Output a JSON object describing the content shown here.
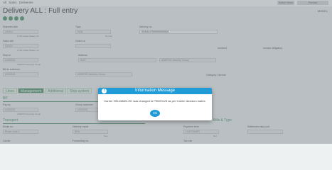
{
  "breadcrumb": [
    "All",
    "Sales",
    "Deliveries"
  ],
  "toolbar": {
    "btn1": "Switch Views",
    "btn2": "Preview"
  },
  "page": {
    "title": "Delivery ALL : Full entry",
    "model_label": "MODEL"
  },
  "header": {
    "shipment_site": {
      "label": "Shipment site",
      "value": "US014",
      "sub": "CT/E United States US"
    },
    "type": {
      "label": "Type",
      "value": "SDN",
      "sub": "Normal"
    },
    "delivery_no": {
      "label": "Delivery no.",
      "value": "SDN1417000090000001"
    },
    "sales_site": {
      "label": "Sales site",
      "value": "US014",
      "sub": "CT/E United States US"
    },
    "order_no": {
      "label": "Order no."
    },
    "checkbox1": "Invoiced",
    "checkbox2": "Invoice obligatory",
    "ship_to": {
      "label": "Ship-to",
      "value": "US00001",
      "sub": "ASEPOS Security Group"
    },
    "address": {
      "label": "Address",
      "value": "SHO",
      "value2": "ASEPOS Security Group"
    },
    "bill_to": {
      "label": "Bill-to customer",
      "value": "US00001",
      "value2": "ASEPOS Security Group"
    },
    "category": "Category: Normal"
  },
  "tabs": [
    "Lines",
    "Management",
    "Additional",
    "Ship system"
  ],
  "bp": {
    "heading": "BP",
    "pay_by": {
      "label": "Pay-by",
      "value": "US00001",
      "sub": "ASEPOS Security Group"
    },
    "group_customer": {
      "label": "Group customer",
      "value": "US00001"
    }
  },
  "transport": {
    "heading": "Transport",
    "route_no": {
      "label": "Route no.",
      "value": "Route code 1"
    },
    "delivery_mode": {
      "label": "Delivery mode",
      "value": "SEA",
      "sub": "Sea"
    },
    "payment_term": {
      "label": "Payment term",
      "value": "CUSTOMER",
      "sub": "Net"
    },
    "settlement_discount": {
      "label": "Settlement discount"
    },
    "carrier": {
      "label": "Carrier"
    },
    "forwarding_no": {
      "label": "Forwarding no."
    },
    "tax_rule": {
      "label": "Tax rule"
    },
    "right_heading": "Bills & Type"
  },
  "dialog": {
    "title": "Information Message",
    "message": "Carrier HELMANN-HK was changed to FEDEXUS as per Carrier decision matrix.",
    "ok_label": "Ok",
    "icon": "info-icon"
  }
}
